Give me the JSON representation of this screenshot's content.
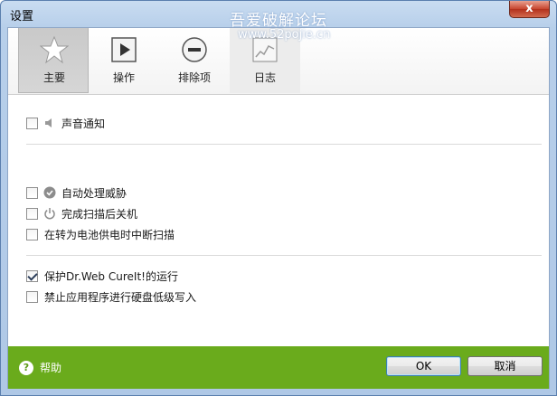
{
  "window": {
    "title": "设置",
    "watermark": "吾爱破解论坛",
    "watermark_url": "www.52pojie.cn",
    "close_label": "x"
  },
  "tabs": [
    {
      "label": "主要",
      "icon": "star-icon",
      "selected": true
    },
    {
      "label": "操作",
      "icon": "play-icon",
      "selected": false
    },
    {
      "label": "排除项",
      "icon": "minus-circle-icon",
      "selected": false
    },
    {
      "label": "日志",
      "icon": "log-chart-icon",
      "selected": false
    }
  ],
  "options": {
    "sound": {
      "label": "声音通知",
      "checked": false,
      "icon": "speaker-icon"
    },
    "auto_threats": {
      "label": "自动处理威胁",
      "checked": false,
      "icon": "check-circle-icon"
    },
    "shutdown": {
      "label": "完成扫描后关机",
      "checked": false,
      "icon": "power-icon"
    },
    "battery": {
      "label": "在转为电池供电时中断扫描",
      "checked": false
    },
    "protect": {
      "label": "保护Dr.Web CureIt!的运行",
      "checked": true
    },
    "disk_write": {
      "label": "禁止应用程序进行硬盘低级写入",
      "checked": false
    }
  },
  "footer": {
    "help_label": "帮助",
    "ok_label": "OK",
    "cancel_label": "取消"
  },
  "colors": {
    "footer_green": "#6aab1c",
    "title_bar": "#b7cfea"
  }
}
